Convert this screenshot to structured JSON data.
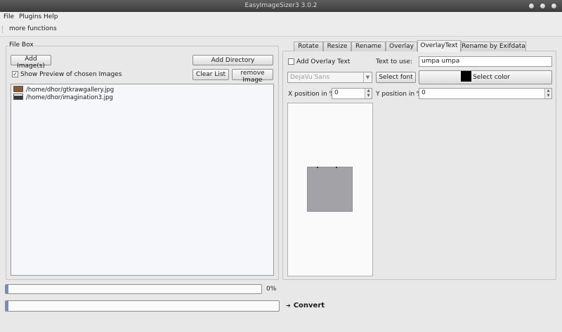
{
  "window": {
    "title": "EasyImageSizer3 3.0.2"
  },
  "menu": {
    "items": [
      "File",
      "Plugins",
      "Help"
    ]
  },
  "toolbar": {
    "more_functions": "more functions"
  },
  "file_box": {
    "title": "File Box",
    "add_images": "Add Image(s)",
    "add_directory": "Add Directory",
    "show_preview": "Show Preview of chosen Images",
    "show_preview_checked": true,
    "clear_list": "Clear List",
    "remove_image": "remove Image",
    "files": [
      {
        "path": "/home/dhor/gtkrawgallery.jpg",
        "thumb_color": "#8a5a2e"
      },
      {
        "path": "/home/dhor/imagination3.jpg",
        "thumb_color": "#3a3a3a"
      }
    ]
  },
  "progress": {
    "value_label": "0%",
    "value": 0
  },
  "convert": {
    "label": "Convert"
  },
  "tabs": [
    {
      "label": "Rotate",
      "active": false
    },
    {
      "label": "Resize",
      "active": false
    },
    {
      "label": "Rename",
      "active": false
    },
    {
      "label": "Overlay",
      "active": false
    },
    {
      "label": "OverlayText",
      "active": true
    },
    {
      "label": "Rename by Exifdata",
      "active": false
    }
  ],
  "overlay_text": {
    "add_overlay_label": "Add Overlay Text",
    "add_overlay_checked": false,
    "text_to_use_label": "Text to use:",
    "text_value": "umpa umpa",
    "font_value": "DejaVu Sans",
    "select_font": "Select font",
    "select_color": "Select color",
    "color_swatch": "#000000",
    "x_label": "X position in %",
    "x_value": "0",
    "y_label": "Y position in %",
    "y_value": "0"
  },
  "colors": {
    "preview_box": "#a3a2a7",
    "title_bar": "#4a4a4a"
  }
}
